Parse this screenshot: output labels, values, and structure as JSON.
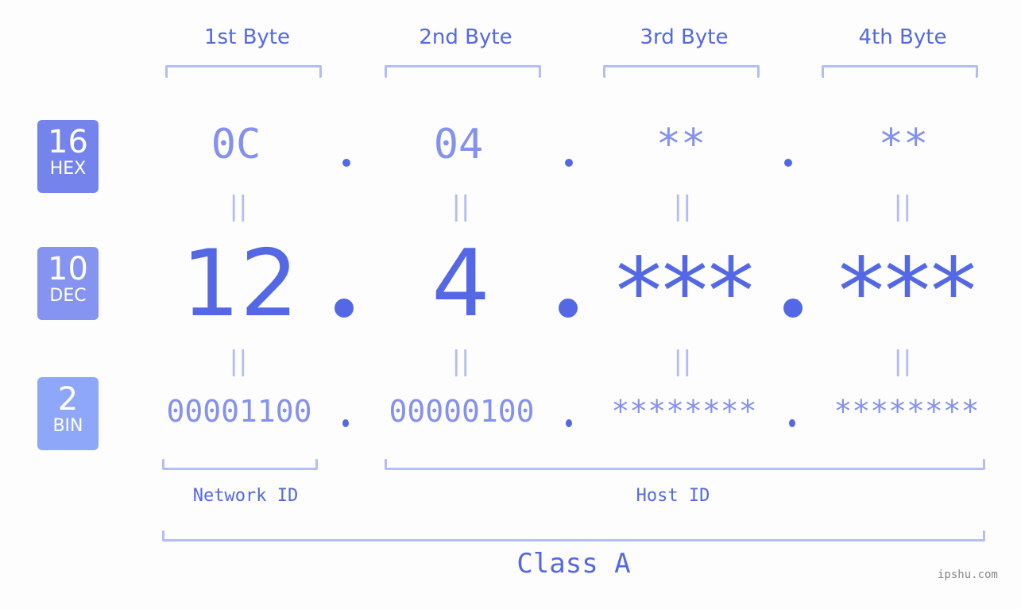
{
  "bytes": {
    "headers": [
      "1st Byte",
      "2nd Byte",
      "3rd Byte",
      "4th Byte"
    ],
    "hex": [
      "0C",
      "04",
      "**",
      "**"
    ],
    "dec": [
      "12",
      "4",
      "***",
      "***"
    ],
    "bin": [
      "00001100",
      "00000100",
      "********",
      "********"
    ]
  },
  "badges": {
    "hex": {
      "num": "16",
      "label": "HEX",
      "color": "#7584ec"
    },
    "dec": {
      "num": "10",
      "label": "DEC",
      "color": "#8594f0"
    },
    "bin": {
      "num": "2",
      "label": "BIN",
      "color": "#8fa7f8"
    }
  },
  "equals_sign": "||",
  "network_id_label": "Network ID",
  "host_id_label": "Host ID",
  "class_label": "Class A",
  "watermark": "ipshu.com",
  "colors": {
    "primary": "#5468e6",
    "secondary": "#8491ee",
    "bracket": "#b4bdf6"
  }
}
